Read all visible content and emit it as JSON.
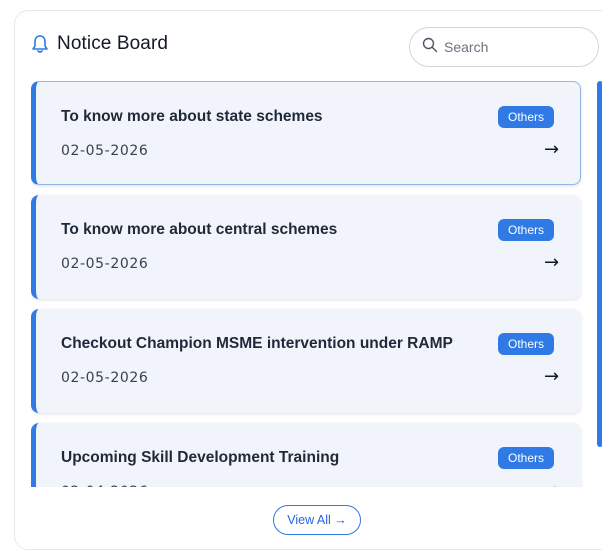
{
  "header": {
    "title": "Notice Board",
    "bell_icon": "bell-icon"
  },
  "search": {
    "placeholder": "Search",
    "icon": "search-icon"
  },
  "notices": [
    {
      "title": "To know more about state schemes",
      "date": "02-05-2026",
      "badge": "Others",
      "arrow": "→"
    },
    {
      "title": "To know more about central schemes",
      "date": "02-05-2026",
      "badge": "Others",
      "arrow": "→"
    },
    {
      "title": "Checkout Champion MSME intervention under RAMP",
      "date": "02-05-2026",
      "badge": "Others",
      "arrow": "→"
    },
    {
      "title": "Upcoming Skill Development Training",
      "date": "02-04-2026",
      "badge": "Others",
      "arrow": "→"
    }
  ],
  "footer": {
    "view_all_label": "View All →"
  },
  "colors": {
    "accent": "#2f7ae5",
    "card_bg": "#f1f5fb"
  }
}
